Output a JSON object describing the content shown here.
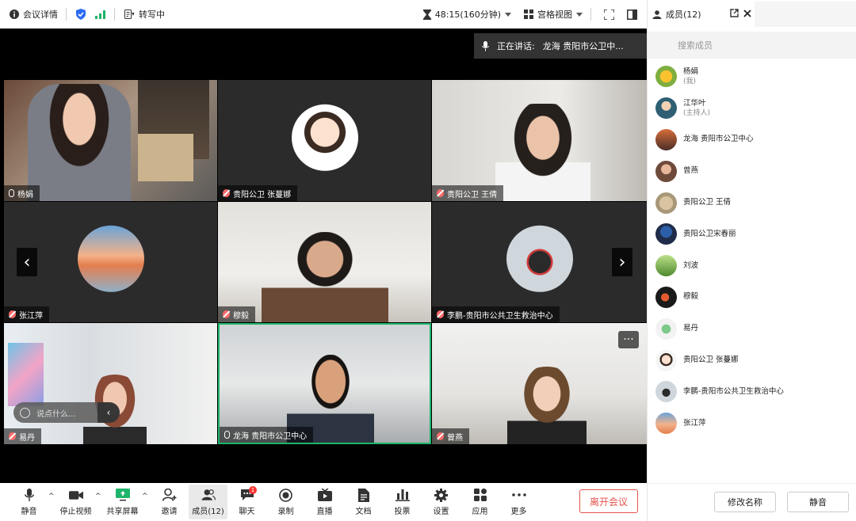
{
  "topbar": {
    "meeting_details": "会议详情",
    "transcribe": "转写中",
    "timer": "48:15(160分钟)",
    "view_mode": "宫格视图"
  },
  "panel": {
    "members_title": "成员(12)",
    "search_placeholder": "搜索成员",
    "rename_button": "修改名称",
    "mute_button": "静音",
    "members": [
      {
        "name": "杨娟",
        "role": "(我)"
      },
      {
        "name": "江华叶",
        "role": "(主持人)"
      },
      {
        "name": "龙海 贵阳市公卫中心",
        "role": ""
      },
      {
        "name": "曾燕",
        "role": ""
      },
      {
        "name": "贵阳公卫 王倩",
        "role": ""
      },
      {
        "name": "贵阳公卫宋春丽",
        "role": ""
      },
      {
        "name": "刘波",
        "role": ""
      },
      {
        "name": "穆毅",
        "role": ""
      },
      {
        "name": "易丹",
        "role": ""
      },
      {
        "name": "贵阳公卫 张蔓娜",
        "role": ""
      },
      {
        "name": "李鹏-贵阳市公共卫生救治中心",
        "role": ""
      },
      {
        "name": "张江萍",
        "role": ""
      }
    ]
  },
  "stage": {
    "speaking_label": "正在讲话:",
    "speaking_name": "龙海 贵阳市公卫中...",
    "chat_placeholder": "说点什么...",
    "tiles": [
      {
        "name": "杨娟"
      },
      {
        "name": "贵阳公卫 张蔓娜"
      },
      {
        "name": "贵阳公卫 王倩"
      },
      {
        "name": "张江萍"
      },
      {
        "name": "穆毅"
      },
      {
        "name": "李鹏-贵阳市公共卫生救治中心"
      },
      {
        "name": "易丹"
      },
      {
        "name": "龙海 贵阳市公卫中心"
      },
      {
        "name": "曾燕"
      }
    ]
  },
  "toolbar": {
    "mute": "静音",
    "stop_video": "停止视频",
    "share_screen": "共享屏幕",
    "invite": "邀请",
    "members": "成员(12)",
    "chat": "聊天",
    "chat_badge": "1",
    "record": "录制",
    "live": "直播",
    "docs": "文档",
    "vote": "投票",
    "settings": "设置",
    "apps": "应用",
    "more": "更多",
    "leave": "离开会议"
  }
}
